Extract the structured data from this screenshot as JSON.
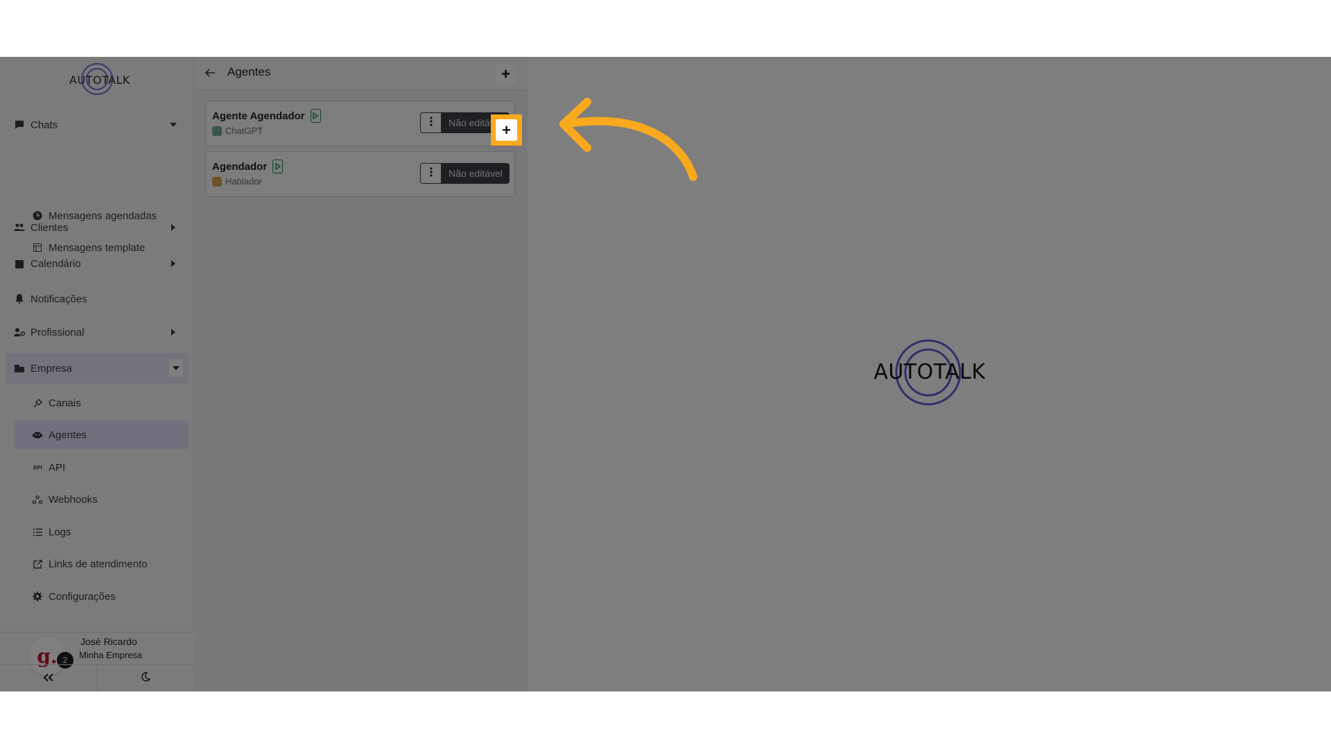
{
  "brand": {
    "logo_text": "AUTOTALK",
    "accent": "#5b5fd6",
    "highlight": "#f9a91d"
  },
  "sidebar": {
    "items": [
      {
        "label": "Chats",
        "icon": "chat-bubble-icon"
      },
      {
        "label": "Mensagens agendadas",
        "icon": "clock-icon"
      },
      {
        "label": "Mensagens template",
        "icon": "template-icon"
      },
      {
        "label": "Clientes",
        "icon": "users-icon"
      },
      {
        "label": "Calendário",
        "icon": "calendar-icon"
      },
      {
        "label": "Notificações",
        "icon": "bell-icon"
      },
      {
        "label": "Profissional",
        "icon": "user-gear-icon"
      },
      {
        "label": "Empresa",
        "icon": "building-icon"
      },
      {
        "label": "Canais",
        "icon": "plug-icon"
      },
      {
        "label": "Agentes",
        "icon": "robot-icon"
      },
      {
        "label": "API",
        "icon": "api-icon"
      },
      {
        "label": "Webhooks",
        "icon": "webhook-icon"
      },
      {
        "label": "Logs",
        "icon": "list-icon"
      },
      {
        "label": "Links de atendimento",
        "icon": "external-link-icon"
      },
      {
        "label": "Configurações",
        "icon": "gear-icon"
      }
    ],
    "user": {
      "name": "José Ricardo",
      "company": "Minha Empresa",
      "avatar_letter": "g.",
      "badge": "2"
    }
  },
  "panel": {
    "title": "Agentes",
    "add_label": "+",
    "agents": [
      {
        "name": "Agente Agendador",
        "model": "ChatGPT",
        "status": "Não editável"
      },
      {
        "name": "Agendador",
        "model": "Hablador",
        "status": "Não editável"
      }
    ]
  }
}
